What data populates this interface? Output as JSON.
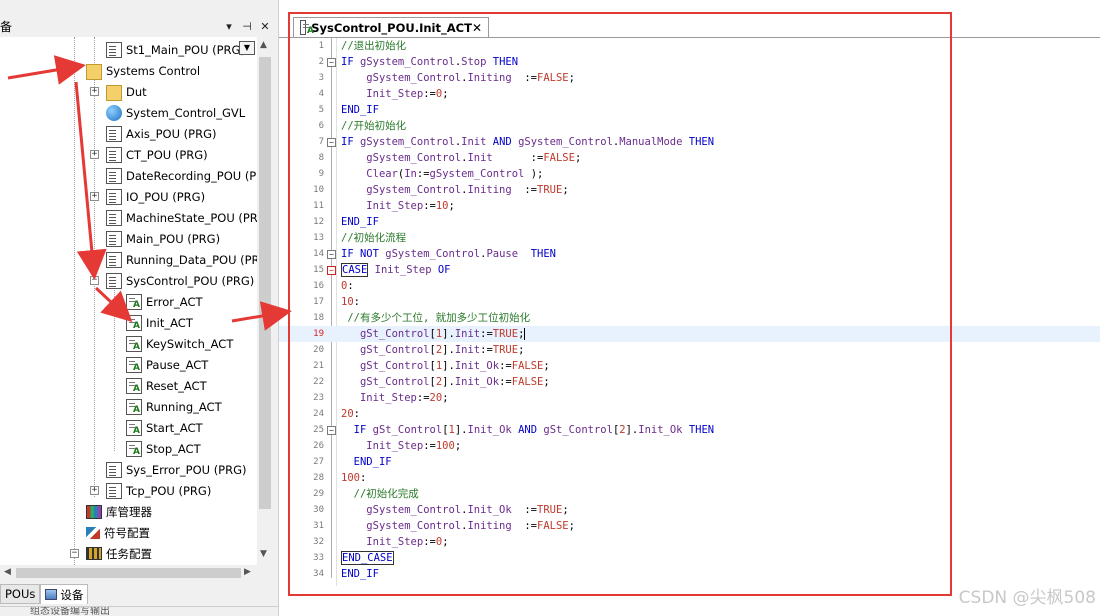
{
  "left_panel": {
    "title": "备",
    "header_buttons": [
      "▾",
      "⊣",
      "✕"
    ],
    "tree": [
      {
        "label": "St1_Main_POU (PRG)",
        "icon": "pou-icon",
        "indent": 1
      },
      {
        "label": "Systems Control",
        "icon": "folder-icon",
        "indent": 0,
        "expanded": true
      },
      {
        "label": "Dut",
        "icon": "folder-icon",
        "indent": 1,
        "expander": "+"
      },
      {
        "label": "System_Control_GVL",
        "icon": "globe-icon",
        "indent": 1
      },
      {
        "label": "Axis_POU (PRG)",
        "icon": "pou-icon",
        "indent": 1
      },
      {
        "label": "CT_POU (PRG)",
        "icon": "pou-icon",
        "indent": 1,
        "expander": "+"
      },
      {
        "label": "DateRecording_POU (PRG)",
        "icon": "pou-icon",
        "indent": 1
      },
      {
        "label": "IO_POU (PRG)",
        "icon": "pou-icon",
        "indent": 1,
        "expander": "+"
      },
      {
        "label": "MachineState_POU (PRG)",
        "icon": "pou-icon",
        "indent": 1
      },
      {
        "label": "Main_POU (PRG)",
        "icon": "pou-icon",
        "indent": 1
      },
      {
        "label": "Running_Data_POU (PRG)",
        "icon": "pou-icon",
        "indent": 1
      },
      {
        "label": "SysControl_POU (PRG)",
        "icon": "pou-icon",
        "indent": 1,
        "expander": "−"
      },
      {
        "label": "Error_ACT",
        "icon": "action-icon",
        "indent": 2
      },
      {
        "label": "Init_ACT",
        "icon": "action-icon",
        "indent": 2
      },
      {
        "label": "KeySwitch_ACT",
        "icon": "action-icon",
        "indent": 2
      },
      {
        "label": "Pause_ACT",
        "icon": "action-icon",
        "indent": 2
      },
      {
        "label": "Reset_ACT",
        "icon": "action-icon",
        "indent": 2
      },
      {
        "label": "Running_ACT",
        "icon": "action-icon",
        "indent": 2
      },
      {
        "label": "Start_ACT",
        "icon": "action-icon",
        "indent": 2
      },
      {
        "label": "Stop_ACT",
        "icon": "action-icon",
        "indent": 2
      },
      {
        "label": "Sys_Error_POU (PRG)",
        "icon": "pou-icon",
        "indent": 1
      },
      {
        "label": "Tcp_POU (PRG)",
        "icon": "pou-icon",
        "indent": 1,
        "expander": "+"
      },
      {
        "label": "库管理器",
        "icon": "library-icon",
        "indent": 0
      },
      {
        "label": "符号配置",
        "icon": "symbol-config-icon",
        "indent": 0
      },
      {
        "label": "任务配置",
        "icon": "task-config-icon",
        "indent": 0,
        "expander": "−"
      }
    ],
    "bottom_tabs": [
      {
        "label": "POUs",
        "active": false
      },
      {
        "label": "设备",
        "active": true
      }
    ],
    "status_text": "组态设备编写输出"
  },
  "editor": {
    "tab_title": "SysControl_POU.Init_ACT",
    "tab_close": "✕",
    "lines": [
      "//退出初始化",
      "IF gSystem_Control.Stop THEN",
      "    gSystem_Control.Initing  :=FALSE;",
      "    Init_Step:=0;",
      "END_IF",
      "//开始初始化",
      "IF gSystem_Control.Init AND gSystem_Control.ManualMode THEN",
      "    gSystem_Control.Init      :=FALSE;",
      "    Clear(In:=gSystem_Control );",
      "    gSystem_Control.Initing  :=TRUE;",
      "    Init_Step:=10;",
      "END_IF",
      "//初始化流程",
      "IF NOT gSystem_Control.Pause  THEN",
      "CASE Init_Step OF",
      "0:",
      "10:",
      " //有多少个工位, 就加多少工位初始化",
      "   gSt_Control[1].Init:=TRUE;",
      "   gSt_Control[2].Init:=TRUE;",
      "   gSt_Control[1].Init_Ok:=FALSE;",
      "   gSt_Control[2].Init_Ok:=FALSE;",
      "   Init_Step:=20;",
      "20:",
      "  IF gSt_Control[1].Init_Ok AND gSt_Control[2].Init_Ok THEN",
      "    Init_Step:=100;",
      "  END_IF",
      "100:",
      "  //初始化完成",
      "    gSystem_Control.Init_Ok  :=TRUE;",
      "    gSystem_Control.Initing  :=FALSE;",
      "    Init_Step:=0;",
      "END_CASE",
      "END_IF"
    ],
    "current_line": 19
  },
  "watermark": "CSDN @尖枫508",
  "colors": {
    "annotation_red": "#e53935",
    "keyword": "#0000cc",
    "comment": "#2a7a2a",
    "literal": "#c0392b",
    "variable": "#6a2c8c"
  }
}
